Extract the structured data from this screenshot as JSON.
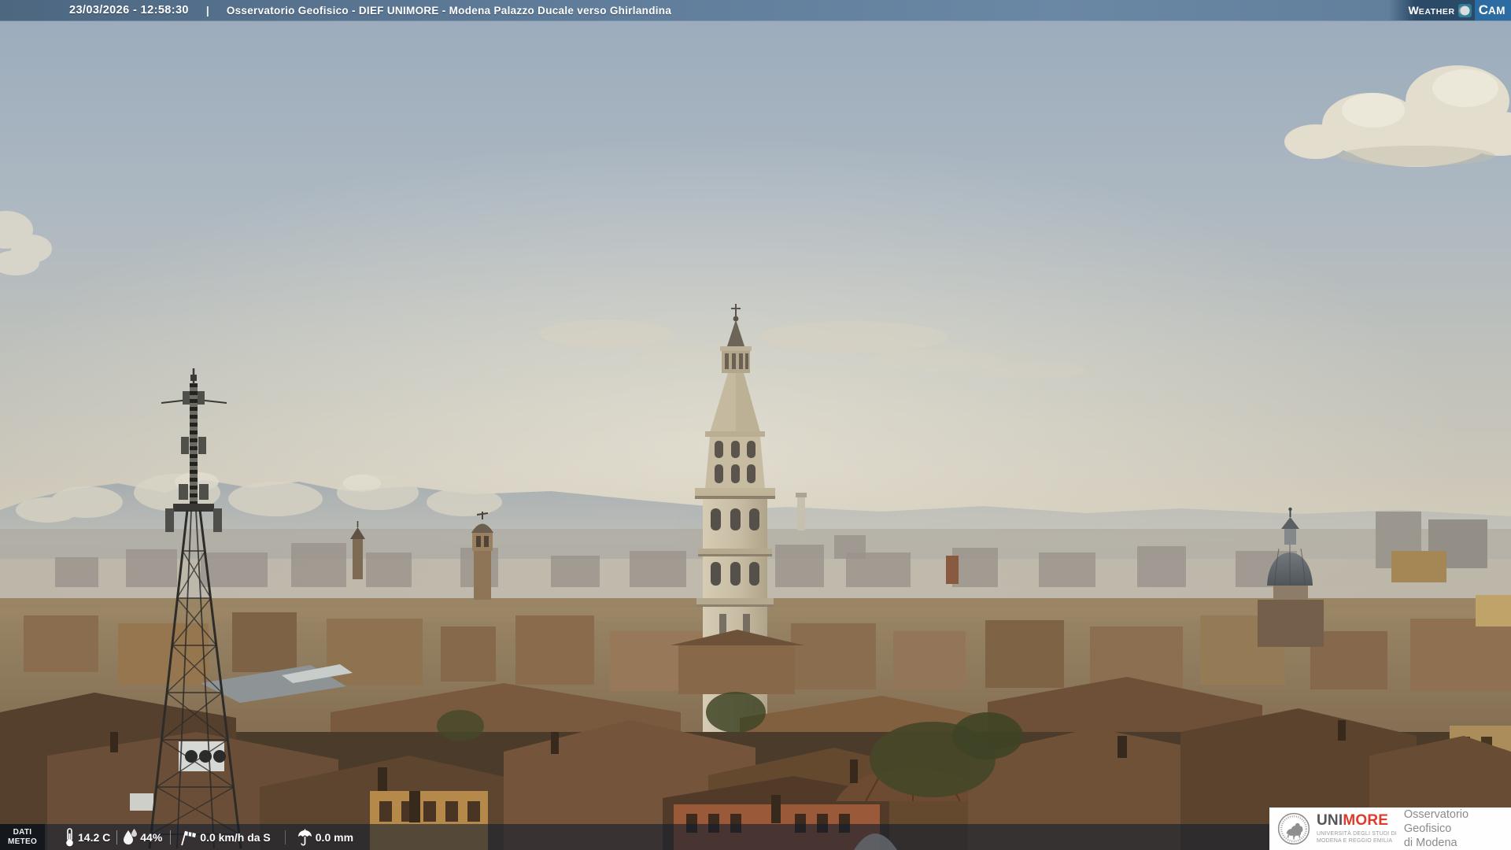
{
  "top_bar": {
    "datetime": "23/03/2026 - 12:58:30",
    "separator": "|",
    "title": "Osservatorio Geofisico - DIEF UNIMORE - Modena Palazzo Ducale verso Ghirlandina",
    "weathercam": {
      "weather_initial": "W",
      "weather_rest": "EATHER",
      "cam_initial": "C",
      "cam_rest": "AM",
      "globe_icon": "globe-icon"
    }
  },
  "meteo_bar": {
    "label_line1": "DATI",
    "label_line2": "METEO",
    "temperature": {
      "value": "14.2 C",
      "icon": "thermometer-icon"
    },
    "humidity": {
      "value": "44%",
      "icon": "humidity-drops-icon"
    },
    "wind": {
      "value": "0.0 km/h da S",
      "icon": "windsock-icon"
    },
    "rain": {
      "value": "0.0 mm",
      "icon": "umbrella-icon"
    }
  },
  "footer_logo": {
    "brand_uni": "UNI",
    "brand_more": "MORE",
    "subtitle_line1": "UNIVERSITÀ DEGLI STUDI DI",
    "subtitle_line2": "MODENA E REGGIO EMILIA",
    "name_line1": "Osservatorio Geofisico",
    "name_line2": "di Modena",
    "seal_icon": "unimore-seal-icon"
  },
  "colors": {
    "top_bar_bg": "#5e7b99",
    "cam_block_bg": "#2d6ba3",
    "globe_teal": "#2f7d96",
    "bottom_bar_bg": "rgba(13,28,44,0.58)",
    "unimore_red": "#e03a2a",
    "text_white": "#ffffff"
  }
}
